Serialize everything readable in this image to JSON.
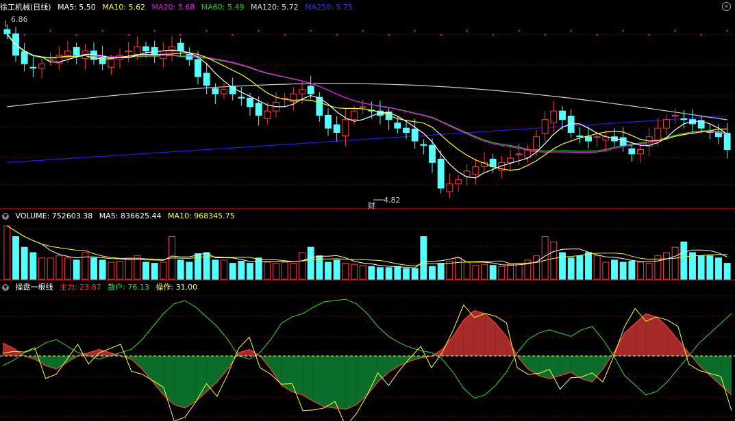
{
  "colors": {
    "up": "#ff3b3b",
    "down": "#54ffff",
    "ma5": "#ffffff",
    "ma10": "#ffff00",
    "ma20": "#ff00ff",
    "ma60": "#00e000",
    "ma120": "#cccccc",
    "ma250": "#1a1aff",
    "main_force": "#ff3b3b",
    "retail": "#33dd33",
    "operation": "#ffff33",
    "grid": "#7a0000"
  },
  "price_panel": {
    "title": "徐工机械(日线)",
    "ma5": "MA5: 5.50",
    "ma10": "MA10: 5.62",
    "ma20": "MA20: 5.68",
    "ma60": "MA60: 5.49",
    "ma120": "MA120: 5.72",
    "ma250": "MA250: 5.75",
    "high_label": "6.86",
    "low_label": "4.82",
    "event_marker": "财"
  },
  "volume_panel": {
    "volume": "VOLUME: 752603.38",
    "ma5": "MA5: 836625.44",
    "ma10": "MA10: 968345.75"
  },
  "indicator_panel": {
    "name": "操盘一根线",
    "main_force": "主力: 23.87",
    "retail": "散户: 76.13",
    "operation": "操作: 31.00"
  },
  "chart_data": [
    {
      "type": "candlestick",
      "title": "徐工机械(日线)",
      "y_range": [
        4.7,
        6.95
      ],
      "visible_high": 6.86,
      "visible_low": 4.82,
      "close_trend": [
        6.7,
        6.45,
        6.35,
        6.3,
        6.35,
        6.4,
        6.45,
        6.5,
        6.45,
        6.5,
        6.4,
        6.35,
        6.4,
        6.45,
        6.5,
        6.55,
        6.5,
        6.45,
        6.5,
        6.55,
        6.5,
        6.4,
        6.2,
        6.1,
        6.0,
        6.05,
        6.0,
        5.95,
        5.85,
        5.75,
        5.8,
        5.9,
        5.95,
        6.0,
        6.05,
        6.0,
        5.75,
        5.6,
        5.55,
        5.7,
        5.8,
        5.85,
        5.8,
        5.75,
        5.7,
        5.6,
        5.55,
        5.45,
        5.4,
        5.2,
        4.9,
        4.95,
        5.0,
        5.1,
        5.15,
        5.2,
        5.15,
        5.2,
        5.25,
        5.3,
        5.35,
        5.5,
        5.7,
        5.8,
        5.7,
        5.55,
        5.5,
        5.45,
        5.5,
        5.5,
        5.45,
        5.4,
        5.3,
        5.35,
        5.5,
        5.6,
        5.7,
        5.75,
        5.7,
        5.65,
        5.6,
        5.55,
        5.5,
        5.35
      ],
      "series": [
        {
          "name": "MA5",
          "value": 5.5
        },
        {
          "name": "MA10",
          "value": 5.62
        },
        {
          "name": "MA20",
          "value": 5.68
        },
        {
          "name": "MA60",
          "value": 5.49
        },
        {
          "name": "MA120",
          "value": 5.72
        },
        {
          "name": "MA250",
          "value": 5.75
        }
      ]
    },
    {
      "type": "bar",
      "title": "VOLUME",
      "values": [
        5,
        4,
        3,
        2.5,
        2,
        2,
        2.2,
        2,
        1.8,
        2.5,
        2,
        1.8,
        1.6,
        1.7,
        2,
        2.2,
        1.6,
        1.5,
        1.6,
        4,
        1.8,
        1.6,
        2.4,
        2.5,
        1.8,
        1.8,
        1.5,
        1.7,
        1.5,
        2,
        1.6,
        1.5,
        1.6,
        1.5,
        2.5,
        3,
        2.2,
        1.6,
        1.8,
        1.5,
        1.4,
        1.3,
        1.2,
        1.1,
        1.1,
        1.2,
        1.0,
        1.0,
        4,
        1.2,
        1.5,
        1.7,
        2,
        1.6,
        1.3,
        1.4,
        1.3,
        1.2,
        1.4,
        1.5,
        1.8,
        2.2,
        4,
        3.5,
        2.5,
        2,
        2.2,
        2.5,
        2.2,
        1.6,
        1.8,
        1.6,
        1.7,
        1.6,
        1.5,
        2.2,
        2.5,
        3,
        3.5,
        2.5,
        2.2,
        2.2,
        2,
        1.5
      ],
      "series": [
        {
          "name": "VOLUME",
          "value": 752603.38
        },
        {
          "name": "MA5",
          "value": 836625.44
        },
        {
          "name": "MA10",
          "value": 968345.75
        }
      ]
    },
    {
      "type": "area",
      "title": "操盘一根线",
      "main_force": [
        20,
        12,
        0,
        -5,
        -15,
        -20,
        -10,
        0,
        5,
        10,
        5,
        0,
        -5,
        -20,
        -40,
        -60,
        -75,
        -80,
        -70,
        -55,
        -40,
        -20,
        5,
        10,
        0,
        -20,
        -45,
        -55,
        -60,
        -70,
        -78,
        -80,
        -82,
        -75,
        -60,
        -40,
        -25,
        -15,
        -8,
        -3,
        0,
        10,
        30,
        55,
        70,
        65,
        50,
        30,
        0,
        -20,
        -30,
        -35,
        -30,
        -25,
        -35,
        -40,
        -20,
        5,
        35,
        50,
        65,
        60,
        45,
        25,
        5,
        -15,
        -30,
        -45,
        -60
      ],
      "retail": [
        80,
        88,
        100,
        105,
        115,
        120,
        110,
        100,
        95,
        90,
        95,
        100,
        105,
        120,
        140,
        160,
        175,
        180,
        170,
        155,
        140,
        120,
        95,
        90,
        100,
        120,
        145,
        155,
        160,
        170,
        178,
        180,
        182,
        175,
        160,
        140,
        125,
        115,
        108,
        103,
        100,
        90,
        70,
        45,
        30,
        35,
        50,
        70,
        100,
        120,
        130,
        135,
        130,
        125,
        135,
        140,
        120,
        95,
        65,
        50,
        35,
        40,
        55,
        75,
        95,
        115,
        130,
        145,
        160
      ],
      "series": [
        {
          "name": "主力",
          "value": 23.87
        },
        {
          "name": "散户",
          "value": 76.13
        },
        {
          "name": "操作",
          "value": 31.0
        }
      ]
    }
  ]
}
